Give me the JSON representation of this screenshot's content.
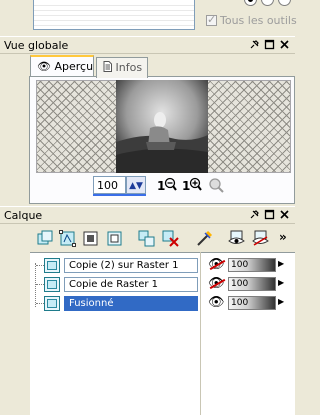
{
  "top_panel": {
    "checkbox_label": "Tous les outils",
    "checked": true
  },
  "overview_panel": {
    "title": "Vue globale",
    "tabs": [
      {
        "label": "Aperçu",
        "active": true
      },
      {
        "label": "Infos",
        "active": false
      }
    ],
    "zoom_value": "100"
  },
  "layers_panel": {
    "title": "Calque",
    "layers": [
      {
        "name": "Copie (2) sur Raster 1",
        "opacity": "100",
        "visible": false,
        "selected": false
      },
      {
        "name": "Copie de Raster 1",
        "opacity": "100",
        "visible": false,
        "selected": false
      },
      {
        "name": "Fusionné",
        "opacity": "100",
        "visible": true,
        "selected": true
      }
    ]
  },
  "colors": {
    "selection": "#316ac5",
    "panel_bg": "#ece9d8"
  },
  "icons": [
    "pin-icon",
    "close-icon",
    "eye-icon",
    "zoom-in-icon",
    "zoom-out-icon",
    "more-icon"
  ]
}
